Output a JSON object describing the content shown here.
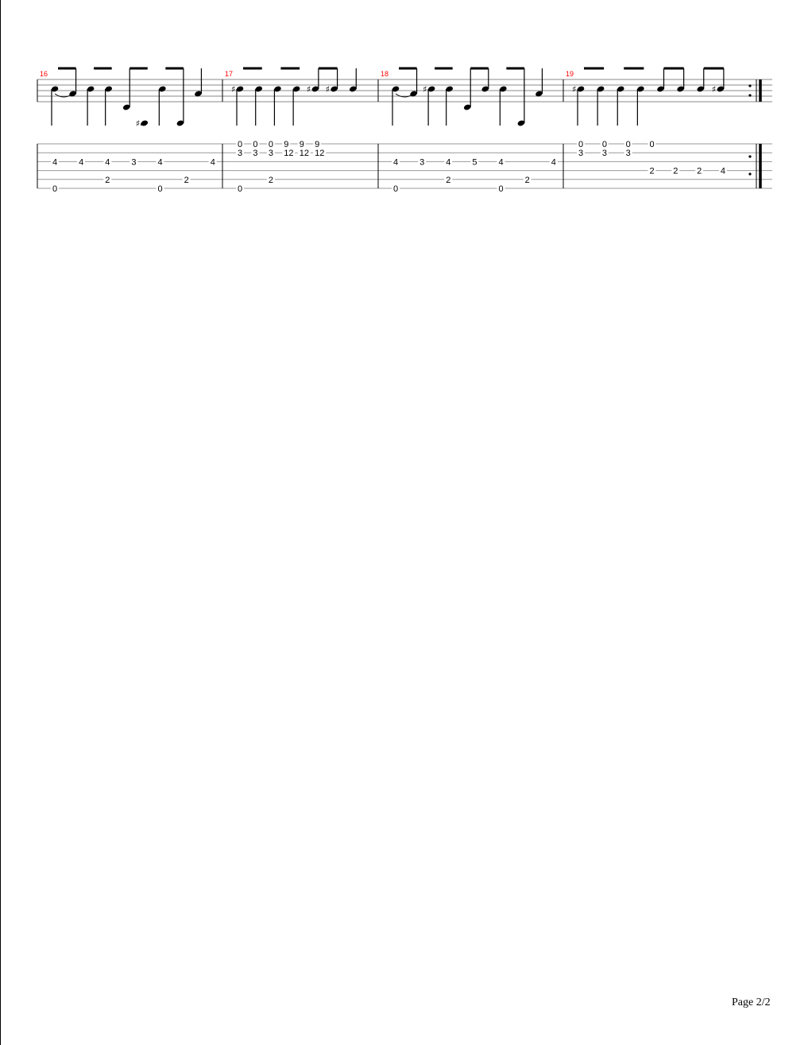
{
  "page": {
    "label": "Page 2/2"
  },
  "colors": {
    "measure_number": "#ff0000",
    "ink": "#000000"
  },
  "measures": [
    {
      "number": "16",
      "notes": [
        {
          "head": 0,
          "stem": "down",
          "beam": "eighth"
        },
        {
          "head": 1,
          "stem": "up",
          "tie": true
        },
        {
          "head": 0,
          "stem": "down"
        },
        {
          "head": 0,
          "stem": "down"
        },
        {
          "head": 2,
          "stem": "up"
        },
        {
          "head": 3,
          "stem": "down",
          "acc": "#"
        },
        {
          "head": 0,
          "stem": "down"
        },
        {
          "head": 3,
          "stem": "up"
        },
        {
          "head": 1,
          "stem": "up"
        }
      ],
      "frets": [
        {
          "s": 2,
          "v": "4"
        },
        {
          "s": 5,
          "v": "0"
        },
        {
          "s": 2,
          "v": "4"
        },
        {
          "s": 2,
          "v": "4"
        },
        {
          "s": 4,
          "v": "2"
        },
        {
          "s": 2,
          "v": "3"
        },
        {
          "s": 2,
          "v": "4"
        },
        {
          "s": 5,
          "v": "0"
        },
        {
          "s": 4,
          "v": "2"
        },
        {
          "s": 2,
          "v": "4"
        }
      ]
    },
    {
      "number": "17",
      "notes": [
        {
          "head": 0,
          "stem": "down",
          "acc": "#"
        },
        {
          "head": 0,
          "stem": "down"
        },
        {
          "head": 0,
          "stem": "down"
        },
        {
          "head": 0,
          "stem": "down"
        },
        {
          "head": 0,
          "stem": "up",
          "acc": "#"
        },
        {
          "head": 0,
          "stem": "up",
          "acc": "#"
        },
        {
          "head": 0,
          "stem": "up"
        }
      ],
      "frets": [
        {
          "s": 0,
          "v": "0"
        },
        {
          "s": 1,
          "v": "3"
        },
        {
          "s": 5,
          "v": "0"
        },
        {
          "s": 0,
          "v": "0"
        },
        {
          "s": 1,
          "v": "3"
        },
        {
          "s": 0,
          "v": "0"
        },
        {
          "s": 1,
          "v": "3"
        },
        {
          "s": 4,
          "v": "2"
        },
        {
          "s": 0,
          "v": "9"
        },
        {
          "s": 1,
          "v": "12"
        },
        {
          "s": 0,
          "v": "9"
        },
        {
          "s": 1,
          "v": "12"
        },
        {
          "s": 0,
          "v": "9"
        },
        {
          "s": 1,
          "v": "12"
        }
      ]
    },
    {
      "number": "18",
      "notes": [
        {
          "head": 0,
          "stem": "down"
        },
        {
          "head": 1,
          "stem": "up",
          "tie": true
        },
        {
          "head": 0,
          "stem": "down",
          "acc": "#"
        },
        {
          "head": 0,
          "stem": "down"
        },
        {
          "head": 2,
          "stem": "up"
        },
        {
          "head": 0,
          "stem": "up"
        },
        {
          "head": 0,
          "stem": "down"
        },
        {
          "head": 3,
          "stem": "up"
        },
        {
          "head": 1,
          "stem": "up"
        }
      ],
      "frets": [
        {
          "s": 2,
          "v": "4"
        },
        {
          "s": 5,
          "v": "0"
        },
        {
          "s": 2,
          "v": "3"
        },
        {
          "s": 2,
          "v": "4"
        },
        {
          "s": 4,
          "v": "2"
        },
        {
          "s": 2,
          "v": "5"
        },
        {
          "s": 2,
          "v": "4"
        },
        {
          "s": 5,
          "v": "0"
        },
        {
          "s": 4,
          "v": "2"
        },
        {
          "s": 2,
          "v": "4"
        }
      ]
    },
    {
      "number": "19",
      "notes": [
        {
          "head": 0,
          "stem": "down",
          "acc": "#"
        },
        {
          "head": 0,
          "stem": "down"
        },
        {
          "head": 0,
          "stem": "down"
        },
        {
          "head": 0,
          "stem": "down"
        },
        {
          "head": 0,
          "stem": "up"
        },
        {
          "head": 0,
          "stem": "up"
        },
        {
          "head": 0,
          "stem": "up"
        },
        {
          "head": 0,
          "stem": "up",
          "acc": "#"
        }
      ],
      "frets": [
        {
          "s": 0,
          "v": "0"
        },
        {
          "s": 1,
          "v": "3"
        },
        {
          "s": 0,
          "v": "0"
        },
        {
          "s": 1,
          "v": "3"
        },
        {
          "s": 0,
          "v": "0"
        },
        {
          "s": 1,
          "v": "3"
        },
        {
          "s": 0,
          "v": "0"
        },
        {
          "s": 3,
          "v": "2"
        },
        {
          "s": 3,
          "v": "2"
        },
        {
          "s": 3,
          "v": "2"
        },
        {
          "s": 3,
          "v": "4"
        }
      ]
    }
  ]
}
